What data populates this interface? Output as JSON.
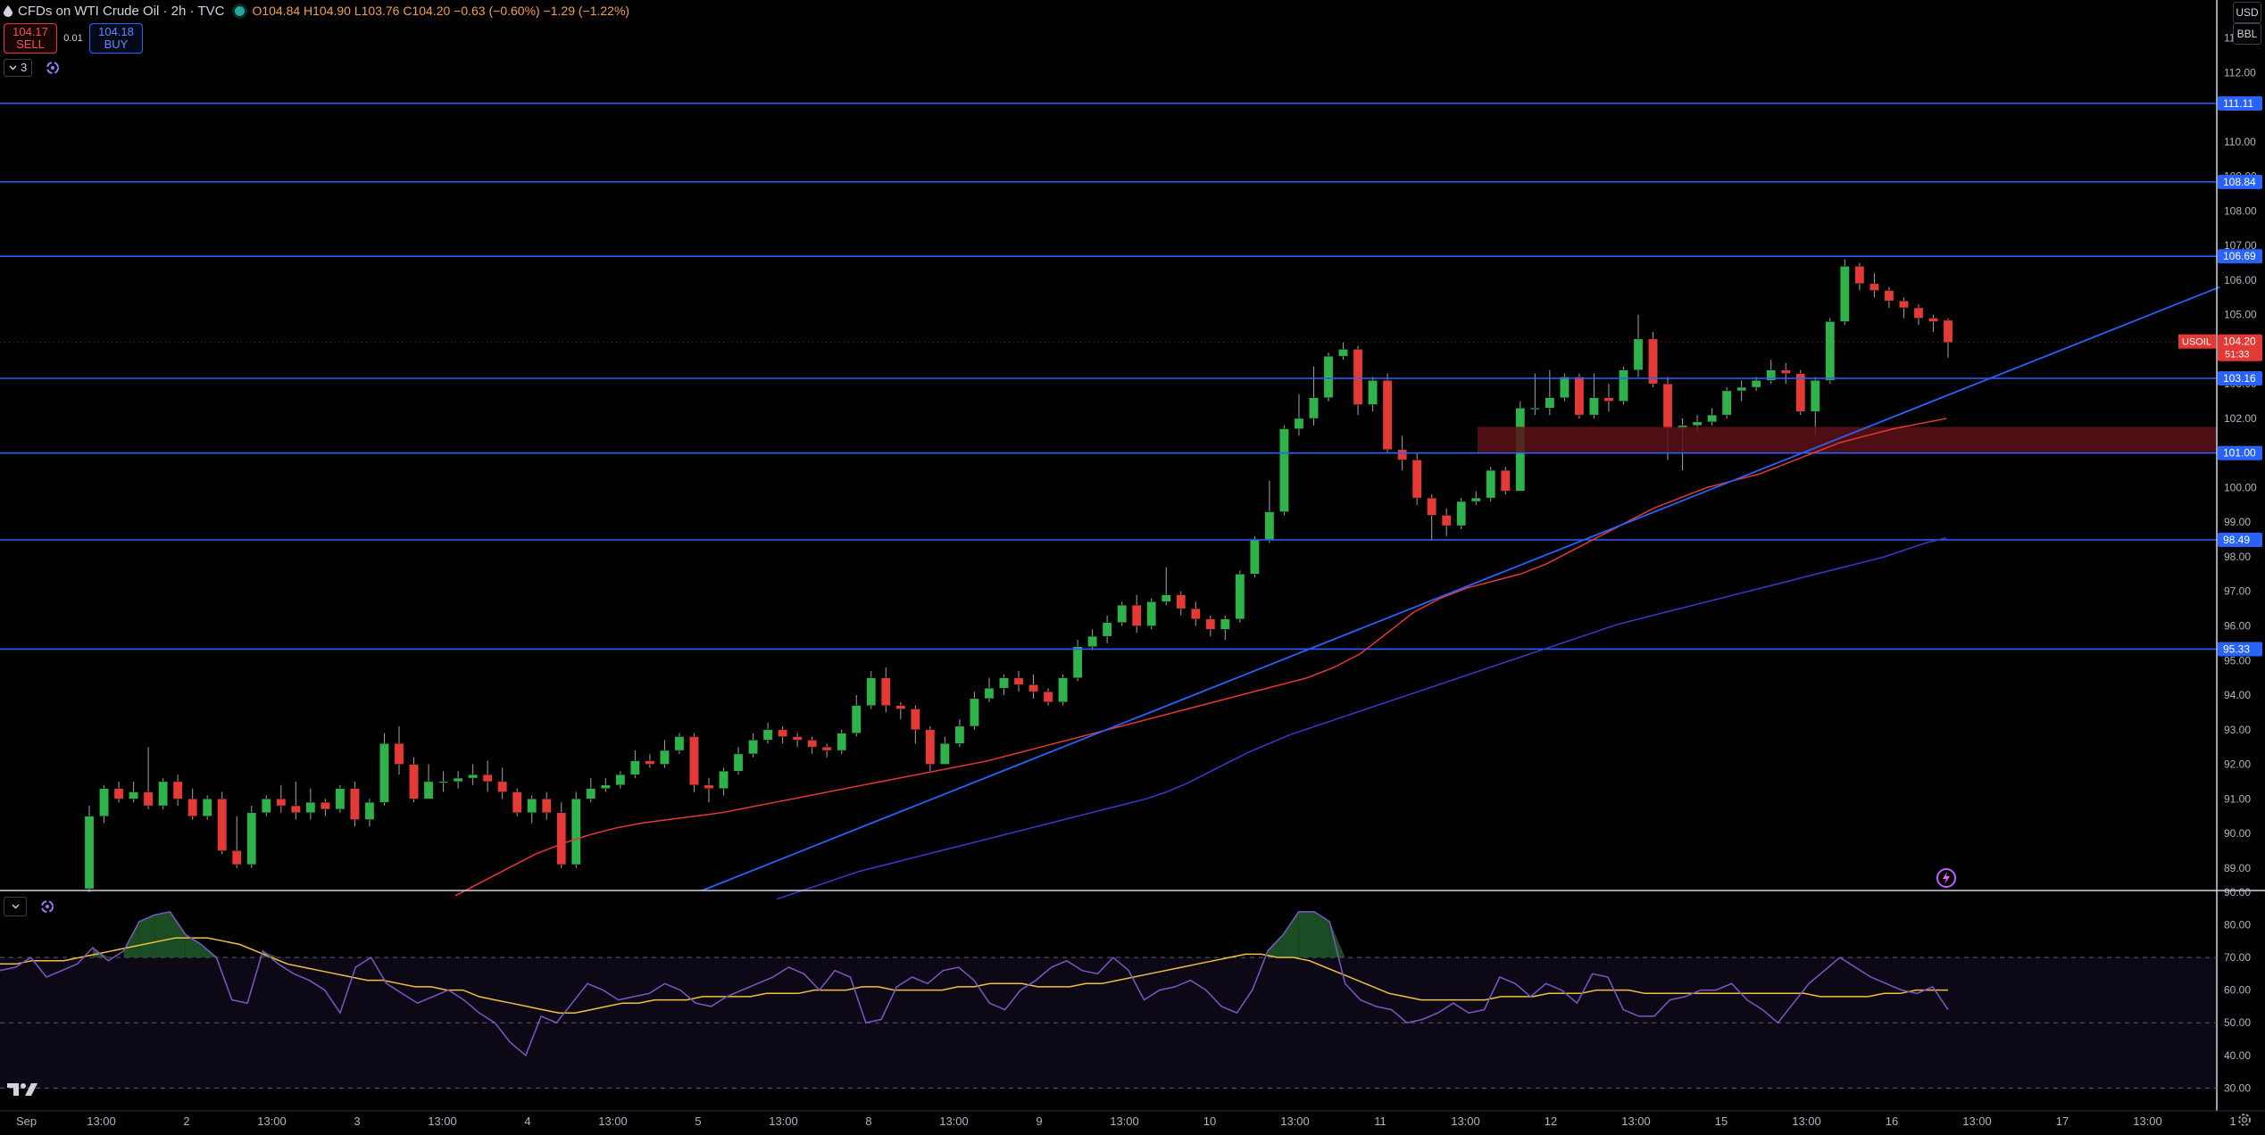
{
  "header": {
    "title": "CFDs on WTI Crude Oil · 2h · TVC",
    "ohlc": "O104.84 H104.90 L103.76 C104.20 −0.63 (−0.60%) −1.29 (−1.22%)"
  },
  "trade": {
    "sell_price": "104.17",
    "sell_label": "SELL",
    "spread": "0.01",
    "buy_price": "104.18",
    "buy_label": "BUY"
  },
  "indicator_count": "3",
  "top_right": {
    "currency": "USD",
    "unit": "BBL"
  },
  "colors": {
    "up": "#26a69a",
    "up_fill": "#2db34a",
    "down": "#e53935",
    "level_line": "#2962ff",
    "ema_fast": "#e53935",
    "ema_slow": "#3a3acf",
    "rsi": "#7e57c2",
    "rsi_ma": "#f0c040",
    "zone": "#5b1018"
  },
  "chart_data": [
    {
      "type": "candlestick",
      "symbol": "USOIL",
      "y_axis_ticks": [
        "89.00",
        "90.00",
        "91.00",
        "92.00",
        "93.00",
        "94.00",
        "95.00",
        "96.00",
        "97.00",
        "98.00",
        "99.00",
        "100.00",
        "101.00",
        "102.00",
        "103.00",
        "104.00",
        "105.00",
        "106.00",
        "107.00",
        "108.00",
        "109.00",
        "110.00",
        "111.00",
        "112.00",
        "113.00"
      ],
      "ylim": [
        88.35,
        114.1
      ],
      "x_axis_labels": [
        "Sep",
        "13:00",
        "2",
        "13:00",
        "3",
        "13:00",
        "4",
        "13:00",
        "5",
        "13:00",
        "8",
        "13:00",
        "9",
        "13:00",
        "10",
        "13:00",
        "11",
        "13:00",
        "12",
        "13:00",
        "15",
        "13:00",
        "16",
        "13:00",
        "17",
        "13:00",
        "1"
      ],
      "candles": [
        [
          88.4,
          90.5,
          88.3,
          90.8
        ],
        [
          90.5,
          91.3,
          90.3,
          91.4
        ],
        [
          91.3,
          91.0,
          90.9,
          91.5
        ],
        [
          91.0,
          91.2,
          90.9,
          91.5
        ],
        [
          91.2,
          90.8,
          90.7,
          92.5
        ],
        [
          90.8,
          91.5,
          90.7,
          91.6
        ],
        [
          91.5,
          91.0,
          90.8,
          91.7
        ],
        [
          91.0,
          90.5,
          90.4,
          91.3
        ],
        [
          90.5,
          91.0,
          90.4,
          91.1
        ],
        [
          91.0,
          89.5,
          89.4,
          91.2
        ],
        [
          89.5,
          89.1,
          89.0,
          90.5
        ],
        [
          89.1,
          90.6,
          89.0,
          90.8
        ],
        [
          90.6,
          91.0,
          90.5,
          91.1
        ],
        [
          91.0,
          90.8,
          90.6,
          91.4
        ],
        [
          90.8,
          90.6,
          90.4,
          91.5
        ],
        [
          90.6,
          90.9,
          90.4,
          91.3
        ],
        [
          90.9,
          90.7,
          90.5,
          91.0
        ],
        [
          90.7,
          91.3,
          90.6,
          91.4
        ],
        [
          91.3,
          90.4,
          90.2,
          91.5
        ],
        [
          90.4,
          90.9,
          90.2,
          91.0
        ],
        [
          90.9,
          92.6,
          90.8,
          92.9
        ],
        [
          92.6,
          92.0,
          91.7,
          93.1
        ],
        [
          92.0,
          91.0,
          90.9,
          92.2
        ],
        [
          91.0,
          91.5,
          91.0,
          92.0
        ],
        [
          91.5,
          91.5,
          91.2,
          91.8
        ],
        [
          91.5,
          91.6,
          91.3,
          91.8
        ],
        [
          91.6,
          91.7,
          91.4,
          92.0
        ],
        [
          91.7,
          91.5,
          91.2,
          92.1
        ],
        [
          91.5,
          91.2,
          91.0,
          91.9
        ],
        [
          91.2,
          90.6,
          90.5,
          91.3
        ],
        [
          90.6,
          91.0,
          90.3,
          91.1
        ],
        [
          91.0,
          90.6,
          90.4,
          91.2
        ],
        [
          90.6,
          89.1,
          89.0,
          90.9
        ],
        [
          89.1,
          91.0,
          89.0,
          91.2
        ],
        [
          91.0,
          91.3,
          90.9,
          91.6
        ],
        [
          91.3,
          91.4,
          91.2,
          91.6
        ],
        [
          91.4,
          91.7,
          91.3,
          91.8
        ],
        [
          91.7,
          92.1,
          91.6,
          92.4
        ],
        [
          92.1,
          92.0,
          91.9,
          92.3
        ],
        [
          92.0,
          92.4,
          91.9,
          92.7
        ],
        [
          92.4,
          92.8,
          92.3,
          92.9
        ],
        [
          92.8,
          91.4,
          91.2,
          92.9
        ],
        [
          91.4,
          91.3,
          90.9,
          91.6
        ],
        [
          91.3,
          91.8,
          91.1,
          91.9
        ],
        [
          91.8,
          92.3,
          91.7,
          92.5
        ],
        [
          92.3,
          92.7,
          92.2,
          92.9
        ],
        [
          92.7,
          93.0,
          92.6,
          93.2
        ],
        [
          93.0,
          92.8,
          92.6,
          93.1
        ],
        [
          92.8,
          92.7,
          92.5,
          92.9
        ],
        [
          92.7,
          92.5,
          92.3,
          92.8
        ],
        [
          92.5,
          92.4,
          92.2,
          92.6
        ],
        [
          92.4,
          92.9,
          92.3,
          93.0
        ],
        [
          92.9,
          93.7,
          92.8,
          94.0
        ],
        [
          93.7,
          94.5,
          93.6,
          94.7
        ],
        [
          94.5,
          93.7,
          93.5,
          94.8
        ],
        [
          93.7,
          93.6,
          93.3,
          93.8
        ],
        [
          93.6,
          93.0,
          92.6,
          93.7
        ],
        [
          93.0,
          92.0,
          91.8,
          93.1
        ],
        [
          92.0,
          92.6,
          92.1,
          92.8
        ],
        [
          92.6,
          93.1,
          92.5,
          93.3
        ],
        [
          93.1,
          93.9,
          93.0,
          94.1
        ],
        [
          93.9,
          94.2,
          93.8,
          94.5
        ],
        [
          94.2,
          94.5,
          94.0,
          94.6
        ],
        [
          94.5,
          94.3,
          94.1,
          94.7
        ],
        [
          94.3,
          94.1,
          93.9,
          94.6
        ],
        [
          94.1,
          93.8,
          93.7,
          94.2
        ],
        [
          93.8,
          94.5,
          93.7,
          94.6
        ],
        [
          94.5,
          95.4,
          94.4,
          95.6
        ],
        [
          95.4,
          95.7,
          95.3,
          95.9
        ],
        [
          95.7,
          96.1,
          95.5,
          96.3
        ],
        [
          96.1,
          96.6,
          96.0,
          96.7
        ],
        [
          96.6,
          96.0,
          95.8,
          96.9
        ],
        [
          96.0,
          96.7,
          95.9,
          96.8
        ],
        [
          96.7,
          96.9,
          96.6,
          97.7
        ],
        [
          96.9,
          96.5,
          96.3,
          97.0
        ],
        [
          96.5,
          96.2,
          96.0,
          96.7
        ],
        [
          96.2,
          95.9,
          95.7,
          96.3
        ],
        [
          95.9,
          96.2,
          95.6,
          96.3
        ],
        [
          96.2,
          97.5,
          96.1,
          97.6
        ],
        [
          97.5,
          98.5,
          97.4,
          98.6
        ],
        [
          98.5,
          99.3,
          98.4,
          100.2
        ],
        [
          99.3,
          101.7,
          99.2,
          101.8
        ],
        [
          101.7,
          102.0,
          101.5,
          102.7
        ],
        [
          102.0,
          102.6,
          101.8,
          103.5
        ],
        [
          102.6,
          103.8,
          102.5,
          103.9
        ],
        [
          103.8,
          104.0,
          103.7,
          104.2
        ],
        [
          104.0,
          102.4,
          102.1,
          104.1
        ],
        [
          102.4,
          103.1,
          102.2,
          103.2
        ],
        [
          103.1,
          101.1,
          101.0,
          103.3
        ],
        [
          101.1,
          100.8,
          100.5,
          101.5
        ],
        [
          100.8,
          99.7,
          99.5,
          101.0
        ],
        [
          99.7,
          99.2,
          98.5,
          99.8
        ],
        [
          99.2,
          98.9,
          98.6,
          99.4
        ],
        [
          98.9,
          99.6,
          98.8,
          99.7
        ],
        [
          99.6,
          99.7,
          99.5,
          99.9
        ],
        [
          99.7,
          100.5,
          99.6,
          100.6
        ],
        [
          100.5,
          99.9,
          99.8,
          100.6
        ],
        [
          99.9,
          102.3,
          102.0,
          102.5
        ],
        [
          102.3,
          102.3,
          102.1,
          103.3
        ],
        [
          102.3,
          102.6,
          102.1,
          103.4
        ],
        [
          102.6,
          103.2,
          102.5,
          103.3
        ],
        [
          103.2,
          102.1,
          102.0,
          103.3
        ],
        [
          102.1,
          102.6,
          102.0,
          103.3
        ],
        [
          102.6,
          102.5,
          102.2,
          103.0
        ],
        [
          102.5,
          103.4,
          102.4,
          103.5
        ],
        [
          103.4,
          104.3,
          103.2,
          105.0
        ],
        [
          104.3,
          103.0,
          102.9,
          104.5
        ],
        [
          103.0,
          101.7,
          100.8,
          103.2
        ],
        [
          101.7,
          101.8,
          100.5,
          102.0
        ],
        [
          101.8,
          101.9,
          101.6,
          102.1
        ],
        [
          101.9,
          102.1,
          101.8,
          102.3
        ],
        [
          102.1,
          102.8,
          102.0,
          102.9
        ],
        [
          102.8,
          102.9,
          102.5,
          103.1
        ],
        [
          102.9,
          103.1,
          102.8,
          103.2
        ],
        [
          103.1,
          103.4,
          103.0,
          103.7
        ],
        [
          103.4,
          103.3,
          103.0,
          103.6
        ],
        [
          103.3,
          102.2,
          102.1,
          103.4
        ],
        [
          102.2,
          103.1,
          101.5,
          103.2
        ],
        [
          103.1,
          104.8,
          103.0,
          104.9
        ],
        [
          104.8,
          106.4,
          104.7,
          106.6
        ],
        [
          106.4,
          105.9,
          105.7,
          106.5
        ],
        [
          105.9,
          105.7,
          105.5,
          106.2
        ],
        [
          105.7,
          105.4,
          105.2,
          105.8
        ],
        [
          105.4,
          105.2,
          104.9,
          105.5
        ],
        [
          105.2,
          104.9,
          104.7,
          105.3
        ],
        [
          104.9,
          104.8,
          104.5,
          105.0
        ],
        [
          104.84,
          104.2,
          103.76,
          104.9
        ]
      ],
      "ema_fast": [
        88.2,
        88.6,
        89.0,
        89.4,
        89.7,
        89.95,
        90.15,
        90.3,
        90.4,
        90.5,
        90.6,
        90.75,
        90.9,
        91.05,
        91.2,
        91.35,
        91.5,
        91.65,
        91.8,
        91.95,
        92.1,
        92.3,
        92.5,
        92.7,
        92.9,
        93.1,
        93.3,
        93.5,
        93.7,
        93.9,
        94.1,
        94.3,
        94.5,
        94.8,
        95.2,
        95.8,
        96.4,
        96.8,
        97.1,
        97.3,
        97.5,
        97.8,
        98.2,
        98.6,
        99.0,
        99.4,
        99.7,
        100.0,
        100.2,
        100.4,
        100.7,
        101.0,
        101.3,
        101.5,
        101.7,
        101.85,
        102.0
      ],
      "ema_slow": [
        88.1,
        88.3,
        88.5,
        88.7,
        88.9,
        89.05,
        89.2,
        89.35,
        89.5,
        89.65,
        89.8,
        89.95,
        90.1,
        90.25,
        90.4,
        90.55,
        90.7,
        90.85,
        91.0,
        91.2,
        91.45,
        91.75,
        92.05,
        92.35,
        92.6,
        92.85,
        93.05,
        93.25,
        93.45,
        93.65,
        93.85,
        94.05,
        94.25,
        94.45,
        94.65,
        94.85,
        95.05,
        95.25,
        95.45,
        95.65,
        95.85,
        96.05,
        96.2,
        96.35,
        96.5,
        96.65,
        96.8,
        96.95,
        97.1,
        97.25,
        97.4,
        97.55,
        97.7,
        97.85,
        98.0,
        98.2,
        98.4,
        98.55
      ],
      "horizontal_levels": [
        "111.11",
        "108.84",
        "106.69",
        "103.16",
        "101.00",
        "98.49",
        "95.33"
      ],
      "zone": [
        101.0,
        101.5
      ],
      "trendline": [
        [
          0.31,
          88.35
        ],
        [
          0.98,
          105.8
        ]
      ],
      "last_price": {
        "label": "USOIL",
        "price": "104.20",
        "countdown": "51:33"
      }
    },
    {
      "type": "line",
      "name": "RSI",
      "y_axis_ticks": [
        "30.00",
        "40.00",
        "50.00",
        "60.00",
        "70.00",
        "80.00",
        "90.00"
      ],
      "ylim": [
        23,
        90.5
      ],
      "bands": [
        30,
        50,
        70
      ],
      "rsi": [
        66,
        67,
        70,
        64,
        66,
        68,
        73,
        69,
        72,
        81,
        83,
        84,
        77,
        74,
        70,
        57,
        56,
        72,
        68,
        65,
        63,
        60,
        53,
        67,
        70,
        62,
        59,
        56,
        58,
        60,
        57,
        53,
        50,
        44,
        40,
        52,
        50,
        56,
        62,
        60,
        57,
        58,
        59,
        62,
        60,
        56,
        55,
        58,
        60,
        62,
        64,
        67,
        65,
        60,
        66,
        64,
        50,
        51,
        61,
        64,
        62,
        66,
        67,
        63,
        56,
        54,
        60,
        63,
        67,
        69,
        66,
        65,
        70,
        66,
        57,
        60,
        61,
        63,
        60,
        55,
        53,
        60,
        72,
        77,
        84,
        84,
        81,
        62,
        57,
        55,
        54,
        50,
        51,
        53,
        56,
        53,
        54,
        64,
        62,
        58,
        62,
        60,
        56,
        65,
        64,
        54,
        52,
        52,
        57,
        58,
        60,
        60,
        62,
        57,
        54,
        50,
        56,
        62,
        66,
        70,
        67,
        64,
        62,
        60,
        59,
        61,
        54
      ],
      "rsi_ma": [
        68,
        68,
        69,
        69,
        69,
        70,
        71,
        72,
        73,
        74,
        75,
        76,
        76,
        76,
        75,
        74,
        72,
        70,
        68,
        67,
        66,
        65,
        64,
        63,
        63,
        62,
        61,
        61,
        60,
        60,
        58,
        57,
        56,
        55,
        54,
        53,
        53,
        54,
        55,
        56,
        56,
        57,
        57,
        57,
        58,
        58,
        58,
        58,
        59,
        59,
        59,
        60,
        60,
        60,
        61,
        61,
        60,
        60,
        60,
        60,
        61,
        61,
        62,
        62,
        62,
        61,
        61,
        61,
        62,
        62,
        63,
        64,
        65,
        66,
        67,
        68,
        69,
        70,
        71,
        71,
        70,
        70,
        69,
        67,
        65,
        63,
        61,
        59,
        58,
        57,
        57,
        57,
        57,
        57,
        58,
        58,
        58,
        59,
        59,
        59,
        60,
        60,
        60,
        59,
        59,
        59,
        59,
        59,
        59,
        59,
        59,
        59,
        59,
        59,
        58,
        58,
        58,
        58,
        59,
        59,
        60,
        60,
        60
      ]
    }
  ]
}
